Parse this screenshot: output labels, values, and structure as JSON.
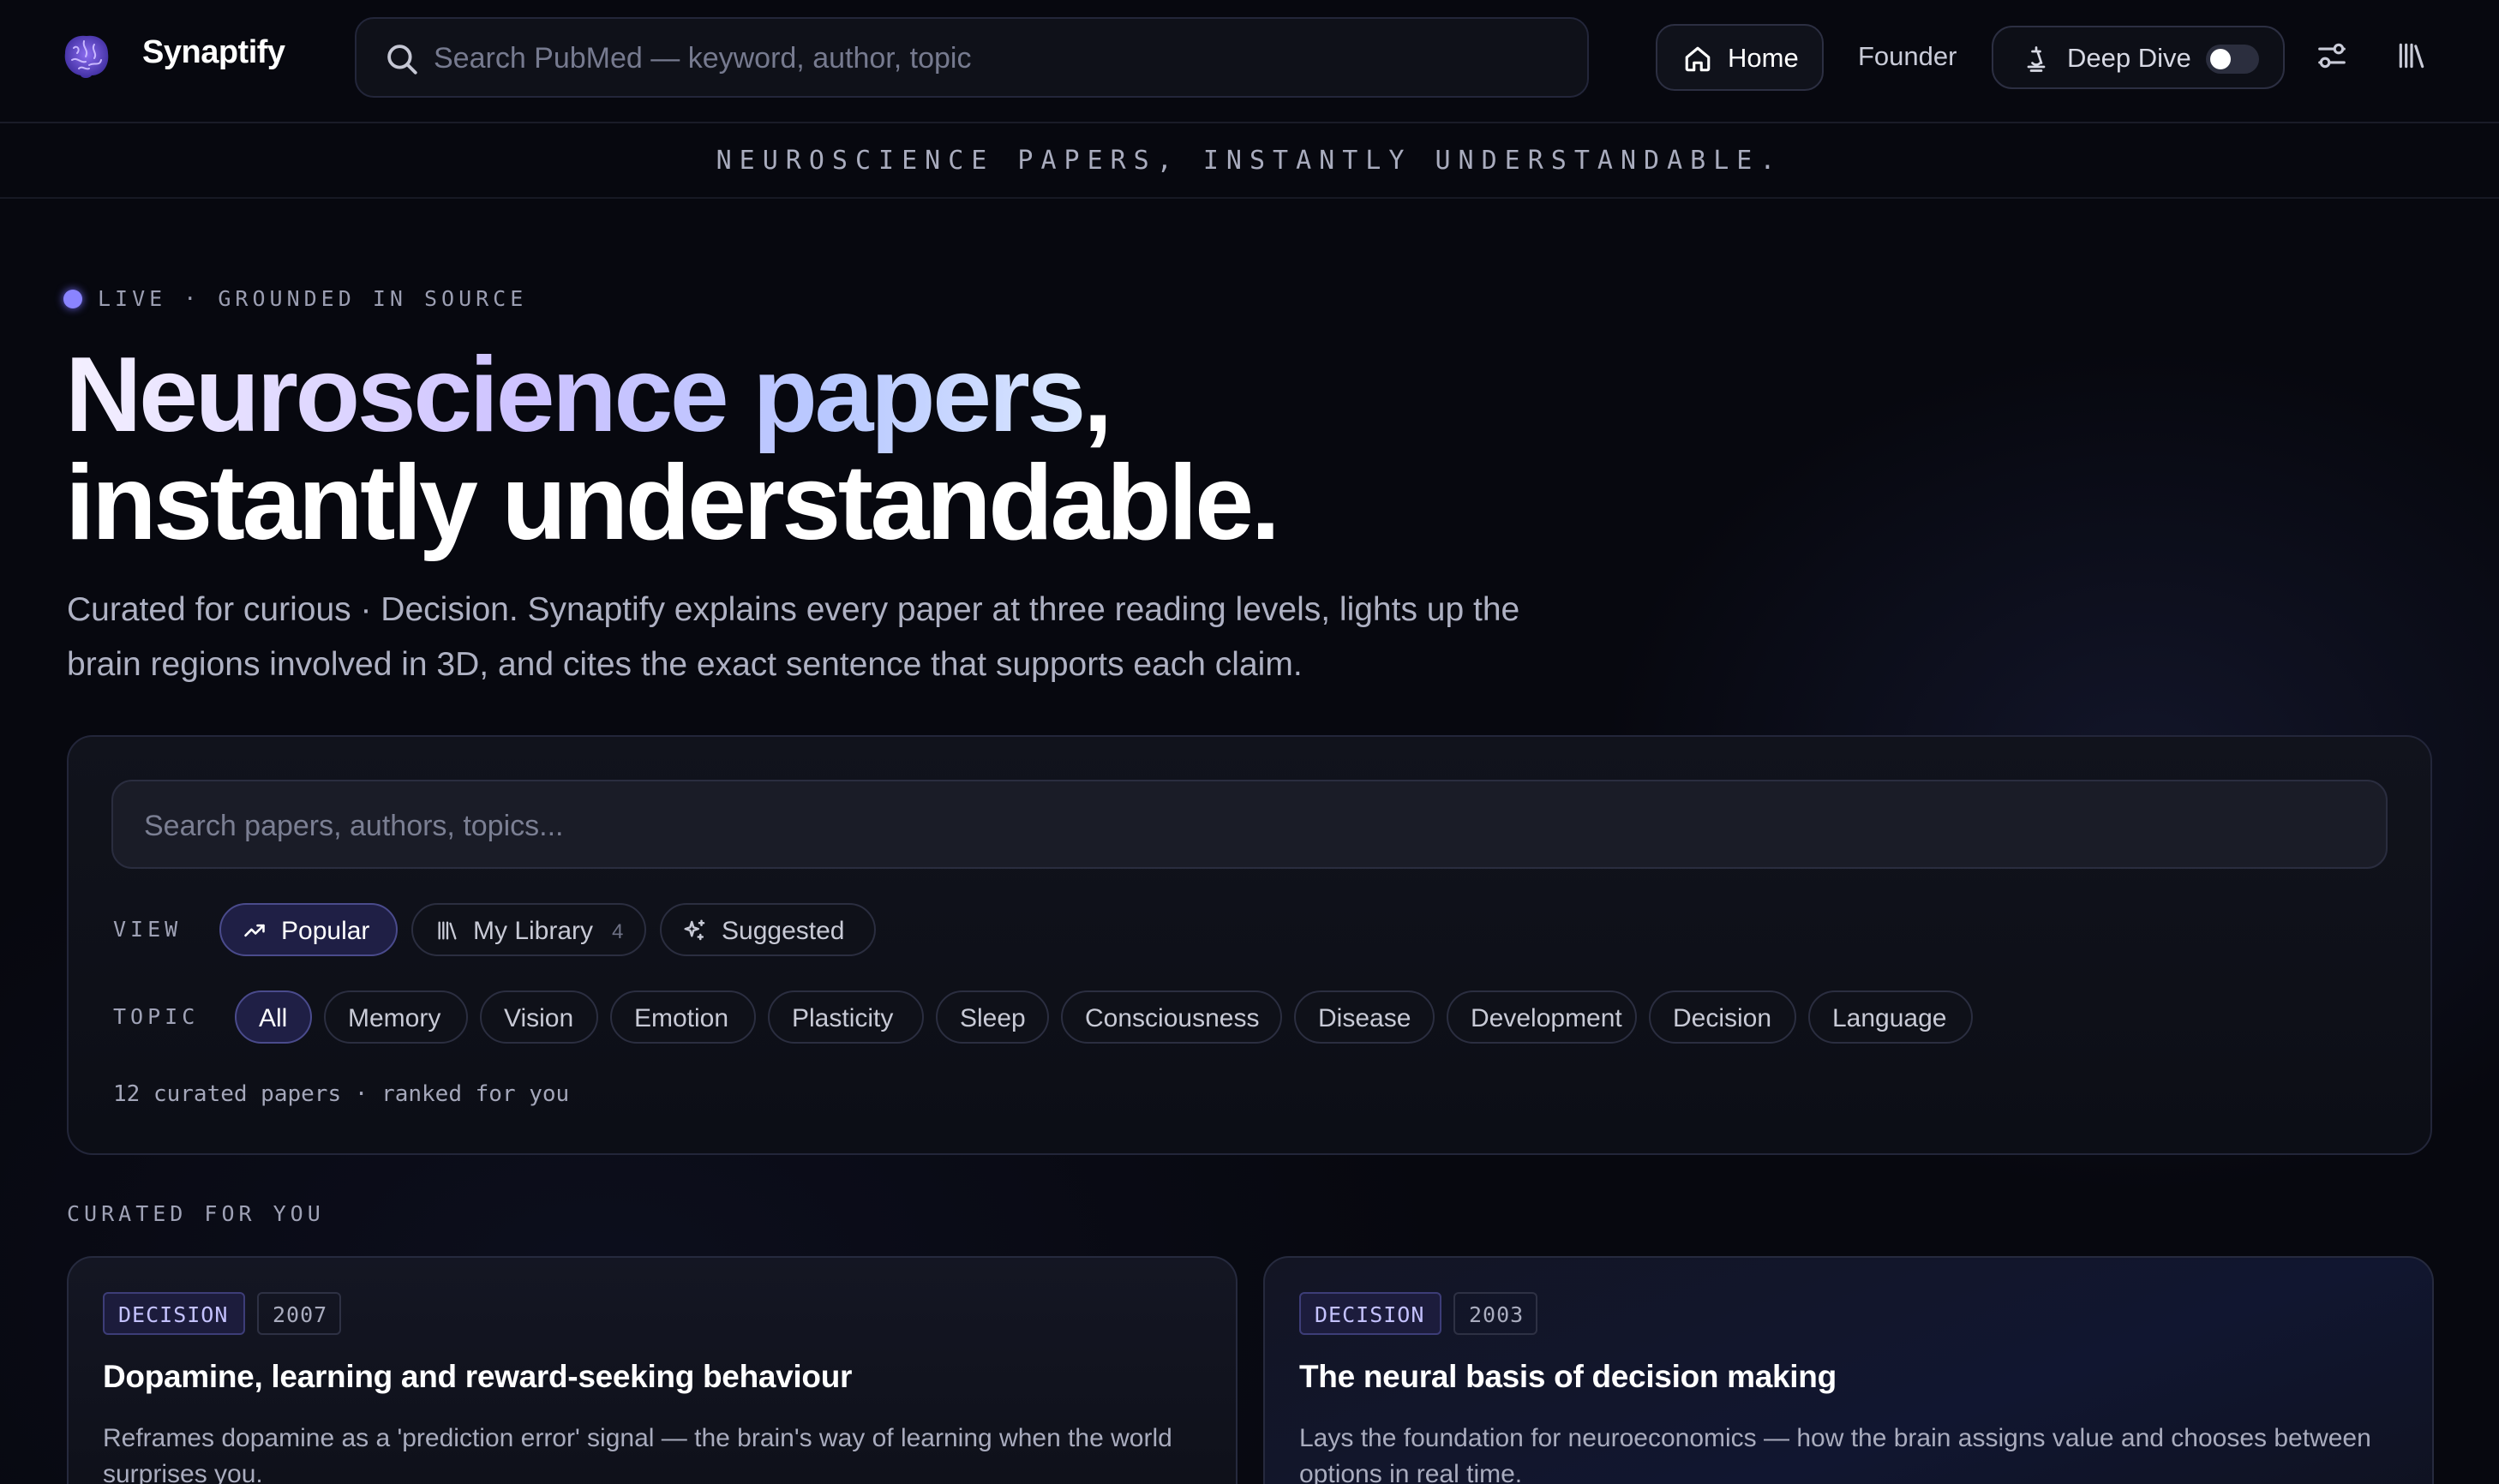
{
  "header": {
    "brand": "Synaptify",
    "search_placeholder": "Search PubMed — keyword, author, topic",
    "nav": {
      "home": "Home",
      "founder": "Founder",
      "deep_dive": "Deep Dive",
      "deep_dive_enabled": false
    },
    "icons": [
      "brain-logo-icon",
      "search-icon",
      "home-icon",
      "deep-dive-icon",
      "settings-sliders-icon",
      "library-icon"
    ]
  },
  "tagline": "NEUROSCIENCE PAPERS, INSTANTLY UNDERSTANDABLE.",
  "hero": {
    "live_label": "LIVE · GROUNDED IN SOURCE",
    "title_highlight": "Neuroscience papers",
    "title_comma": ",",
    "title_line2": "instantly understandable.",
    "description": "Curated for curious · Decision. Synaptify explains every paper at three reading levels, lights up the brain regions involved in 3D, and cites the exact sentence that supports each claim."
  },
  "panel": {
    "search_placeholder": "Search papers, authors, topics...",
    "view_label": "VIEW",
    "views": [
      {
        "label": "Popular",
        "active": true
      },
      {
        "label": "My Library",
        "count": "4",
        "active": false
      },
      {
        "label": "Suggested",
        "active": false
      }
    ],
    "topic_label": "TOPIC",
    "topics": [
      "All",
      "Memory",
      "Vision",
      "Emotion",
      "Plasticity",
      "Sleep",
      "Consciousness",
      "Disease",
      "Development",
      "Decision",
      "Language"
    ],
    "active_topic": "All",
    "meta": "12 curated papers · ranked for you"
  },
  "section_label": "CURATED FOR YOU",
  "cards": [
    {
      "topic": "DECISION",
      "year": "2007",
      "title": "Dopamine, learning and reward-seeking behaviour",
      "summary": "Reframes dopamine as a 'prediction error' signal — the brain's way of learning when the world surprises you."
    },
    {
      "topic": "DECISION",
      "year": "2003",
      "title": "The neural basis of decision making",
      "summary": "Lays the foundation for neuroeconomics — how the brain assigns value and chooses between options in real time."
    }
  ],
  "colors": {
    "background": "#07080f",
    "accent": "#8a84ff",
    "active_pill": "#1f1f45",
    "text_primary": "#ffffff",
    "text_muted": "#aeb1c3"
  }
}
